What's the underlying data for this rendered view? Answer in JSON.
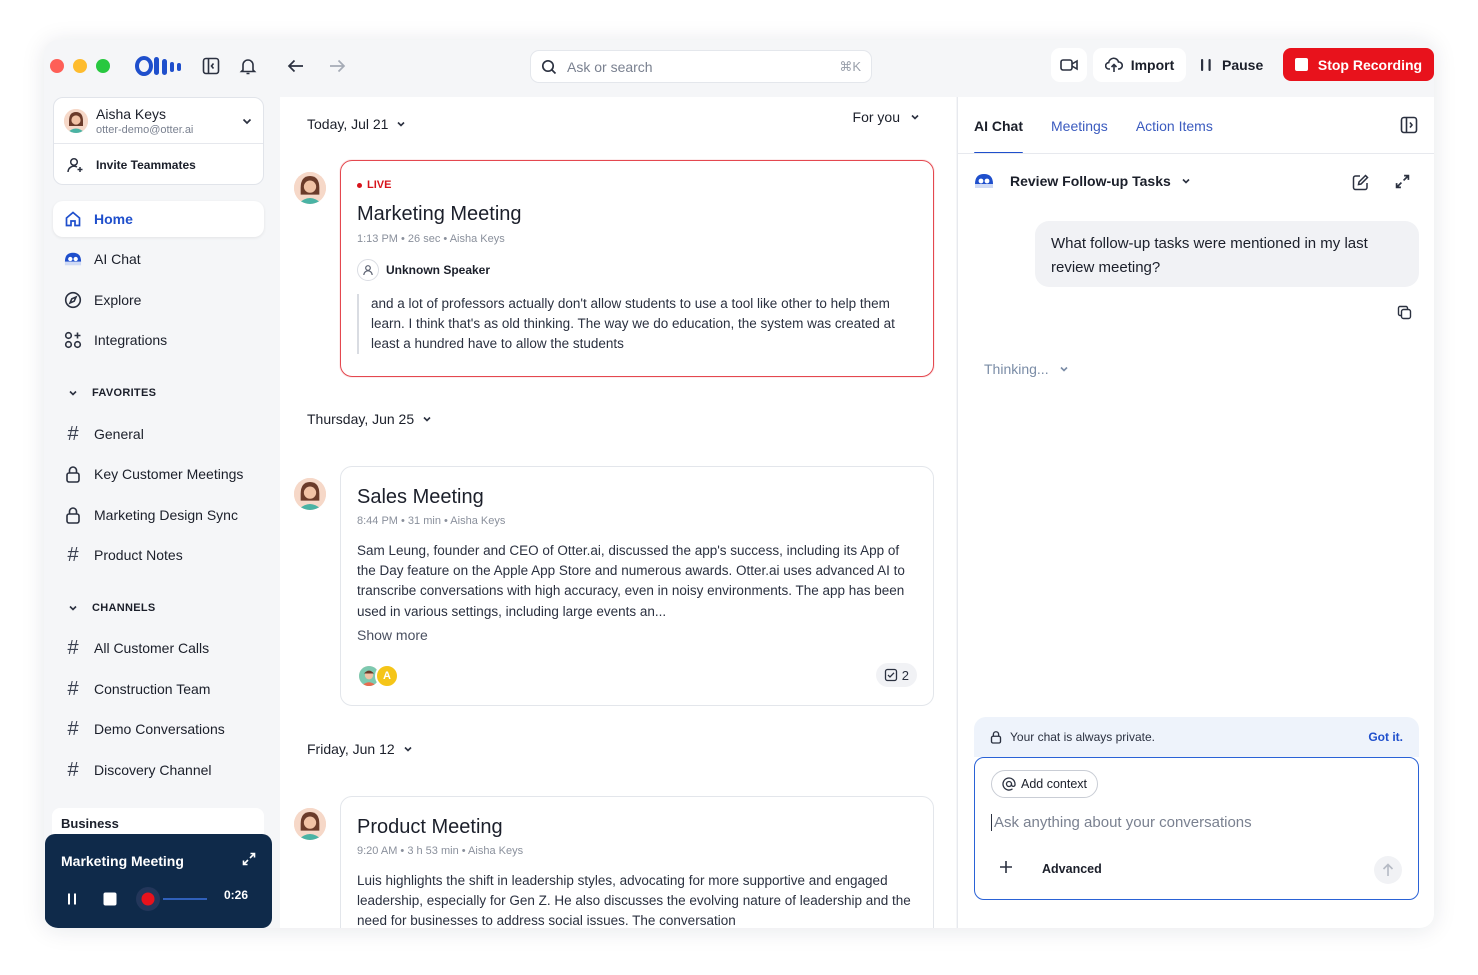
{
  "topbar": {
    "search_placeholder": "Ask or search",
    "search_shortcut": "⌘K",
    "import_label": "Import",
    "pause_label": "Pause",
    "stop_label": "Stop Recording",
    "accent_color": "#e8121c"
  },
  "user": {
    "name": "Aisha Keys",
    "email": "otter-demo@otter.ai",
    "invite_label": "Invite Teammates"
  },
  "nav": [
    {
      "label": "Home",
      "icon": "home-icon",
      "active": true
    },
    {
      "label": "AI Chat",
      "icon": "otter-ai-icon"
    },
    {
      "label": "Explore",
      "icon": "compass-icon"
    },
    {
      "label": "Integrations",
      "icon": "apps-icon"
    }
  ],
  "favorites": {
    "label": "FAVORITES",
    "items": [
      {
        "label": "General",
        "icon": "hash-icon"
      },
      {
        "label": "Key Customer Meetings",
        "icon": "lock-icon"
      },
      {
        "label": "Marketing Design Sync",
        "icon": "lock-icon"
      },
      {
        "label": "Product Notes",
        "icon": "hash-icon"
      }
    ]
  },
  "channels": {
    "label": "CHANNELS",
    "items": [
      {
        "label": "All Customer Calls"
      },
      {
        "label": "Construction Team"
      },
      {
        "label": "Demo Conversations"
      },
      {
        "label": "Discovery Channel"
      }
    ]
  },
  "business_label": "Business",
  "player": {
    "title": "Marketing Meeting",
    "time": "0:26"
  },
  "feed": {
    "filter_label": "For you",
    "groups": [
      {
        "date": "Today, Jul 21",
        "card": {
          "live_label": "LIVE",
          "title": "Marketing Meeting",
          "meta": "1:13 PM • 26 sec • Aisha Keys",
          "speaker": "Unknown Speaker",
          "text": "and a lot of professors actually don't allow students to use a tool like other to help them learn. I think that's as old thinking. The way we do education, the system was created at least a hundred have to allow the students"
        }
      },
      {
        "date": "Thursday, Jun 25",
        "card": {
          "title": "Sales Meeting",
          "meta": "8:44 PM • 31 min • Aisha Keys",
          "text": "Sam Leung, founder and CEO of Otter.ai, discussed the app's success, including its App of the Day feature on the Apple App Store and numerous awards. Otter.ai uses advanced AI to transcribe conversations with high accuracy, even in noisy environments. The app has been used in various settings, including large events an...",
          "show_more": "Show more",
          "avatar_letter": "A",
          "task_count": "2"
        }
      },
      {
        "date": "Friday, Jun 12",
        "card": {
          "title": "Product Meeting",
          "meta": "9:20 AM • 3 h 53 min • Aisha Keys",
          "text": "Luis highlights the shift in leadership styles, advocating for more supportive and engaged leadership, especially for Gen Z. He also discusses the evolving nature of leadership and the need for businesses to address social issues. The conversation"
        }
      }
    ]
  },
  "right_panel": {
    "tabs": [
      {
        "label": "AI Chat",
        "active": true
      },
      {
        "label": "Meetings"
      },
      {
        "label": "Action Items"
      }
    ],
    "chat_title": "Review Follow-up Tasks",
    "user_message": "What follow-up tasks were mentioned in my last review meeting?",
    "thinking_label": "Thinking...",
    "private_notice": "Your chat is always private.",
    "got_it_label": "Got it.",
    "add_context_label": "Add context",
    "input_placeholder": "Ask anything about your conversations",
    "advanced_label": "Advanced"
  }
}
